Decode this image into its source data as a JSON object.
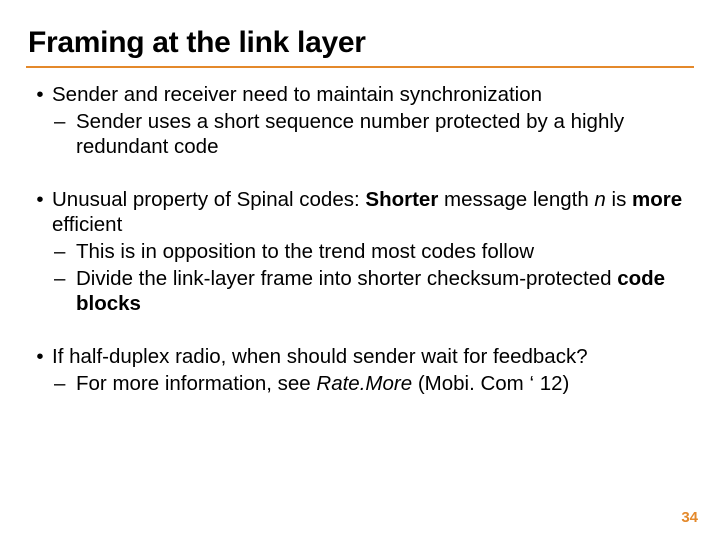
{
  "title": "Framing at the link layer",
  "b1": {
    "l1": "Sender and receiver need to maintain synchronization",
    "s1": "Sender uses a short sequence number protected by a highly redundant code"
  },
  "b2": {
    "l1a": "Unusual property of Spinal codes: ",
    "l1b": "Shorter",
    "l1c": " message length ",
    "l1d": "n",
    "l1e": " is ",
    "l1f": "more",
    "l1g": " efficient",
    "s1": "This is in opposition to the trend most codes follow",
    "s2a": "Divide the link-layer frame into shorter checksum-protected ",
    "s2b": "code blocks"
  },
  "b3": {
    "l1": "If half-duplex radio, when should sender wait for feedback?",
    "s1a": "For more information, see ",
    "s1b": "Rate.More",
    "s1c": " (Mobi. Com ‘ 12)"
  },
  "pagenum": "34"
}
